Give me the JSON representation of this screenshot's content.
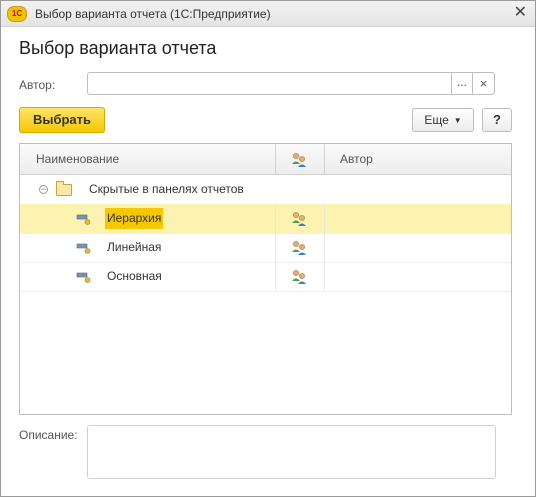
{
  "window": {
    "title": "Выбор варианта отчета  (1С:Предприятие)",
    "logo_text": "1С",
    "close_glyph": "✕"
  },
  "heading": "Выбор варианта отчета",
  "author": {
    "label": "Автор:",
    "value": "",
    "dots": "...",
    "clear": "×"
  },
  "toolbar": {
    "select_label": "Выбрать",
    "more_label": "Еще",
    "help_label": "?"
  },
  "table": {
    "columns": {
      "name": "Наименование",
      "author": "Автор"
    },
    "group": {
      "label": "Скрытые в панелях отчетов",
      "expanded": true
    },
    "rows": [
      {
        "name": "Иерархия",
        "author": "",
        "selected": true
      },
      {
        "name": "Линейная",
        "author": "",
        "selected": false
      },
      {
        "name": "Основная",
        "author": "",
        "selected": false
      }
    ]
  },
  "description": {
    "label": "Описание:",
    "value": ""
  },
  "colors": {
    "accent": "#f5c800",
    "selected_row": "#fdf3b0"
  }
}
